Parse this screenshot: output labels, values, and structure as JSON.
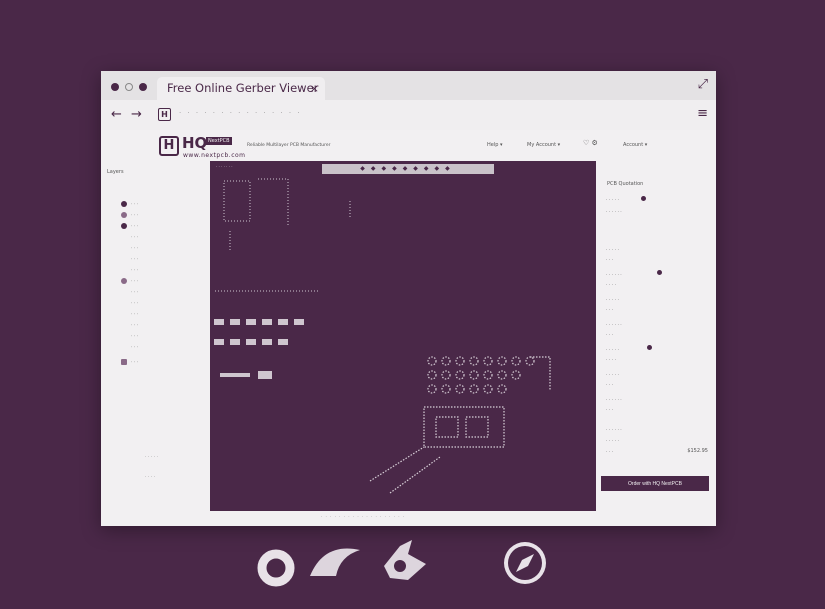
{
  "window": {
    "tab_title": "Free Online Gerber Viewer",
    "tab_close": "×",
    "fullscreen_glyph": "⤢",
    "back_glyph": "←",
    "forward_glyph": "→",
    "site_glyph": "H",
    "menu_glyph": "≡"
  },
  "header": {
    "logo_letter": "H",
    "logo_text": "HQ",
    "logo_badge": "NextPCB",
    "logo_sub": "www.nextpcb.com",
    "tagline": "Reliable Multilayer PCB Manufacturer",
    "help": "Help ▾",
    "my_account": "My Account ▾",
    "account": "Account ▾"
  },
  "layers": {
    "title": "Layers"
  },
  "quote": {
    "title": "PCB Quotation",
    "total": "$152.95",
    "order_button": "Order with HQ NextPCB"
  },
  "colors": {
    "accent": "#4a2848",
    "window": "#f0eef0"
  }
}
